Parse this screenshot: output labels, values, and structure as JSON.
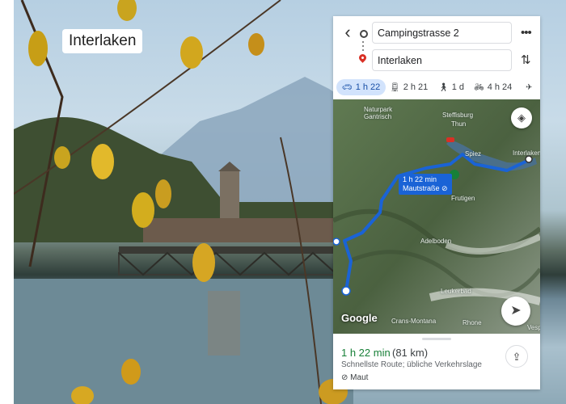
{
  "photo": {
    "place_label": "Interlaken"
  },
  "maps": {
    "origin": "Campingstrasse 2",
    "destination": "Interlaken",
    "modes": [
      {
        "name": "car",
        "label": "1 h 22",
        "active": true
      },
      {
        "name": "transit",
        "label": "2 h 21"
      },
      {
        "name": "walk",
        "label": "1 d"
      },
      {
        "name": "bike",
        "label": "4 h 24"
      }
    ],
    "map_labels": {
      "naturpark": "Naturpark\nGantrisch",
      "steffisburg": "Steffisburg",
      "thun": "Thun",
      "spiez": "Spiez",
      "interlaken": "Interlaken",
      "frutigen": "Frutigen",
      "adelboden": "Adelboden",
      "leukerbad": "Leukerbad",
      "crans_montana": "Crans-Montana",
      "rhone": "Rhone",
      "vesp": "Vesp"
    },
    "route_badge": {
      "time": "1 h 22 min",
      "toll": "Mautstraße"
    },
    "logo": "Google",
    "summary": {
      "duration": "1 h 22 min",
      "distance": "(81 km)",
      "subtitle": "Schnellste Route; übliche Verkehrslage",
      "toll_label": "Maut"
    },
    "colors": {
      "route": "#1a63d6",
      "duration_green": "#188038",
      "active_mode_bg": "#d2e3fc"
    }
  }
}
